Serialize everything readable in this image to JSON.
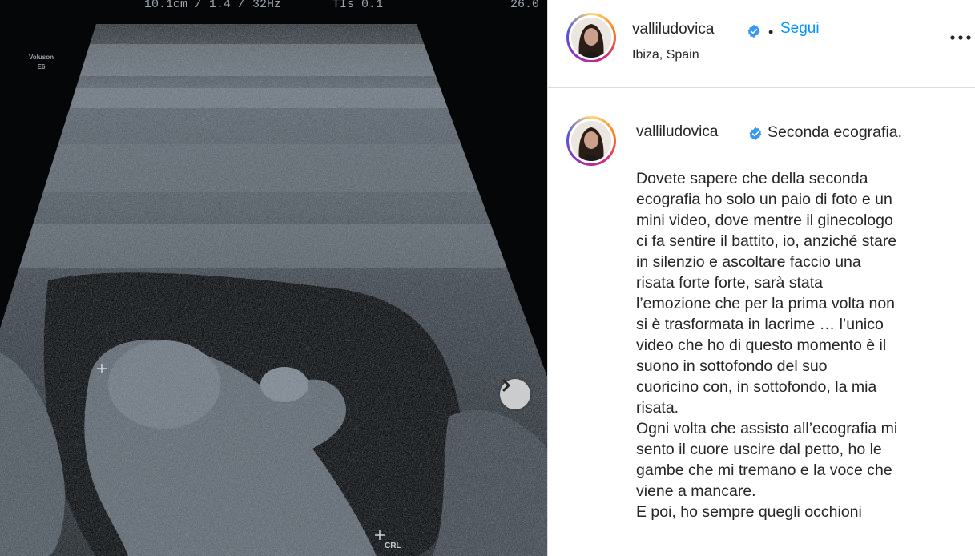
{
  "media": {
    "scan_header": {
      "depth": "10.1cm / 1.4 / 32Hz",
      "tis": "TIs 0.1",
      "time": "26.0"
    },
    "side_label": {
      "line1": "Voluson",
      "line2": "E6"
    },
    "crl_label": "CRL",
    "next_icon": "chevron-right-icon"
  },
  "post": {
    "username": "valliludovica",
    "follow_label": "Segui",
    "separator": "•",
    "location": "Ibiza, Spain",
    "more_icon": "more-horizontal-icon",
    "verified_icon": "verified-badge-icon"
  },
  "caption": {
    "username": "valliludovica",
    "first_line": "Seconda ecografia.",
    "lines": [
      "Dovete sapere che della seconda",
      "ecografia ho solo un paio di foto e un",
      "mini video, dove mentre il ginecologo",
      "ci fa sentire il battito, io, anziché stare",
      "in silenzio e ascoltare faccio una",
      "risata forte forte, sarà stata",
      "l’emozione che per la prima volta non",
      "si è trasformata in lacrime … l’unico",
      "video che ho di questo momento è il",
      "suono in sottofondo del suo",
      "cuoricino con, in sottofondo, la mia",
      "risata.",
      "Ogni volta che assisto all’ecografia mi",
      "sento il cuore uscire dal petto, ho le",
      "gambe che mi tremano e la voce che",
      "viene a mancare.",
      "E poi, ho sempre quegli occhioni"
    ]
  },
  "colors": {
    "link_blue": "#0095f6",
    "verified_blue": "#3897f0",
    "text": "#262626"
  }
}
